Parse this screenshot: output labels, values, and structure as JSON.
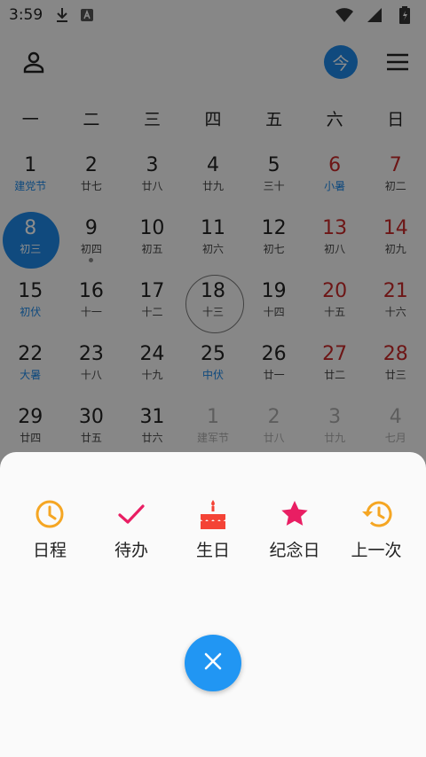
{
  "status_bar": {
    "time": "3:59"
  },
  "header": {
    "today_label": "今"
  },
  "weekdays": [
    "一",
    "二",
    "三",
    "四",
    "五",
    "六",
    "日"
  ],
  "calendar": {
    "weeks": [
      [
        {
          "day": "1",
          "lunar": "建党节"
        },
        {
          "day": "2",
          "lunar": "廿七"
        },
        {
          "day": "3",
          "lunar": "廿八"
        },
        {
          "day": "4",
          "lunar": "廿九"
        },
        {
          "day": "5",
          "lunar": "三十"
        },
        {
          "day": "6",
          "lunar": "小暑"
        },
        {
          "day": "7",
          "lunar": "初二"
        }
      ],
      [
        {
          "day": "8",
          "lunar": "初三"
        },
        {
          "day": "9",
          "lunar": "初四"
        },
        {
          "day": "10",
          "lunar": "初五"
        },
        {
          "day": "11",
          "lunar": "初六"
        },
        {
          "day": "12",
          "lunar": "初七"
        },
        {
          "day": "13",
          "lunar": "初八"
        },
        {
          "day": "14",
          "lunar": "初九"
        }
      ],
      [
        {
          "day": "15",
          "lunar": "初伏"
        },
        {
          "day": "16",
          "lunar": "十一"
        },
        {
          "day": "17",
          "lunar": "十二"
        },
        {
          "day": "18",
          "lunar": "十三"
        },
        {
          "day": "19",
          "lunar": "十四"
        },
        {
          "day": "20",
          "lunar": "十五"
        },
        {
          "day": "21",
          "lunar": "十六"
        }
      ],
      [
        {
          "day": "22",
          "lunar": "大暑"
        },
        {
          "day": "23",
          "lunar": "十八"
        },
        {
          "day": "24",
          "lunar": "十九"
        },
        {
          "day": "25",
          "lunar": "中伏"
        },
        {
          "day": "26",
          "lunar": "廿一"
        },
        {
          "day": "27",
          "lunar": "廿二"
        },
        {
          "day": "28",
          "lunar": "廿三"
        }
      ],
      [
        {
          "day": "29",
          "lunar": "廿四"
        },
        {
          "day": "30",
          "lunar": "廿五"
        },
        {
          "day": "31",
          "lunar": "廿六"
        },
        {
          "day": "1",
          "lunar": "建军节"
        },
        {
          "day": "2",
          "lunar": "廿八"
        },
        {
          "day": "3",
          "lunar": "廿九"
        },
        {
          "day": "4",
          "lunar": "七月"
        }
      ]
    ]
  },
  "sheet": {
    "actions": [
      {
        "label": "日程",
        "icon": "clock-icon",
        "color": "#f5a623"
      },
      {
        "label": "待办",
        "icon": "check-icon",
        "color": "#e91e63"
      },
      {
        "label": "生日",
        "icon": "cake-icon",
        "color": "#f44336"
      },
      {
        "label": "纪念日",
        "icon": "star-icon",
        "color": "#e91e63"
      },
      {
        "label": "上一次",
        "icon": "history-icon",
        "color": "#f5a623"
      }
    ]
  },
  "colors": {
    "accent": "#1e88e5",
    "weekend": "#c62828",
    "fab": "#2196f3"
  }
}
